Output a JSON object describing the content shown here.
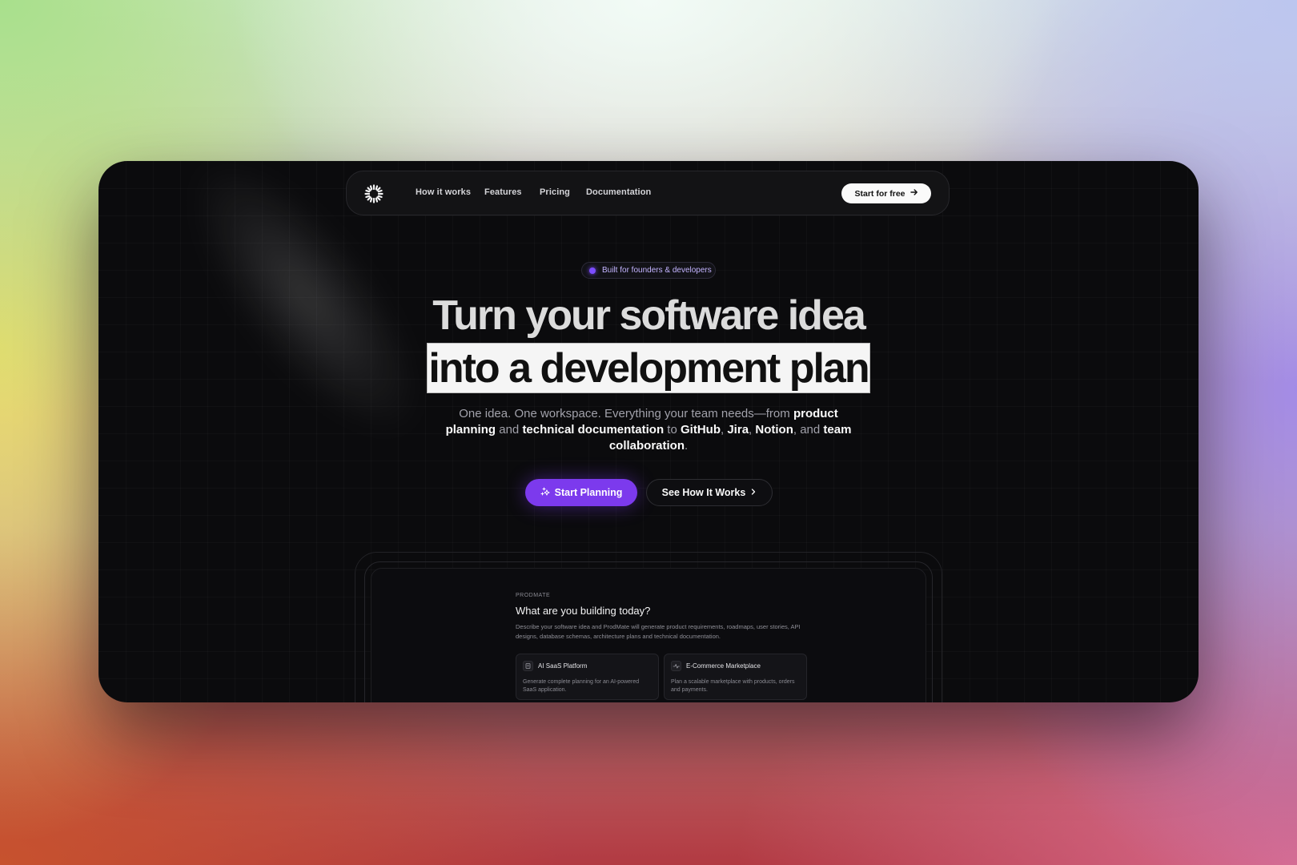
{
  "nav": {
    "links": [
      "How it works",
      "Features",
      "Pricing",
      "Documentation"
    ],
    "cta_label": "Start for free"
  },
  "badge": {
    "text": "Built for founders & developers"
  },
  "hero": {
    "headline_line1": "Turn your software idea",
    "headline_line2": "into a development plan",
    "subtitle_parts": [
      "One idea. One workspace. Everything your team needs—from ",
      "product planning",
      " and ",
      "technical documentation",
      " to ",
      "GitHub",
      ", ",
      "Jira",
      ", ",
      "Notion",
      ", and ",
      "team collaboration",
      "."
    ],
    "primary_button": "Start Planning",
    "secondary_button": "See How It Works"
  },
  "preview": {
    "brand": "PRODMATE",
    "question": "What are you building today?",
    "description": "Describe your software idea and ProdMate will generate product requirements, roadmaps, user stories, API designs, database schemas, architecture plans and technical documentation.",
    "cards": [
      {
        "title": "AI SaaS Platform",
        "description": "Generate complete planning for an AI-powered SaaS application."
      },
      {
        "title": "E-Commerce Marketplace",
        "description": "Plan a scalable marketplace with products, orders and payments."
      }
    ]
  },
  "colors": {
    "accent": "#7c3aed",
    "frame_bg": "#0b0b0d",
    "nav_bg": "#131315"
  },
  "icons": [
    "logo-starburst-icon",
    "arrow-right-icon",
    "sparkle-icon",
    "chevron-right-icon",
    "document-icon",
    "activity-icon"
  ]
}
